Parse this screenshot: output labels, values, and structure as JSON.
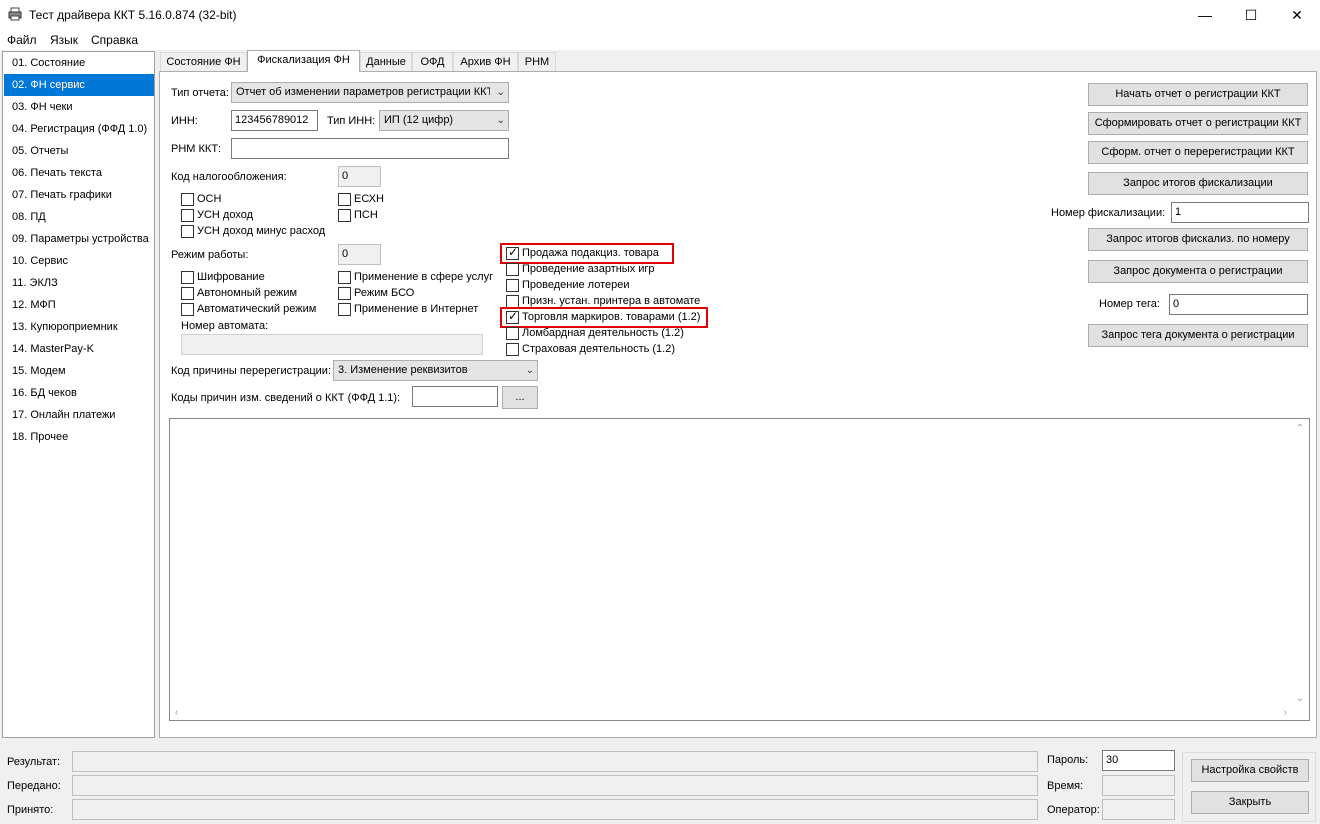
{
  "window": {
    "title": "Тест драйвера ККТ 5.16.0.874 (32-bit)",
    "minimize": "—",
    "maximize": "☐",
    "close": "✕"
  },
  "menu": [
    "Файл",
    "Язык",
    "Справка"
  ],
  "sidebar": {
    "items": [
      "01. Состояние",
      "02. ФН сервис",
      "03. ФН чеки",
      "04. Регистрация (ФФД 1.0)",
      "05. Отчеты",
      "06. Печать текста",
      "07. Печать графики",
      "08. ПД",
      "09. Параметры устройства",
      "10. Сервис",
      "11. ЭКЛЗ",
      "12. МФП",
      "13. Купюроприемник",
      "14. MasterPay-K",
      "15. Модем",
      "16. БД чеков",
      "17. Онлайн платежи",
      "18. Прочее"
    ],
    "selected": "02. ФН сервис"
  },
  "tabs": [
    "Состояние ФН",
    "Фискализация ФН",
    "Данные",
    "ОФД",
    "Архив ФН",
    "РНМ"
  ],
  "form": {
    "report_type_label": "Тип отчета:",
    "report_type_value": "Отчет об изменении параметров регистрации ККТ",
    "inn_label": "ИНН:",
    "inn_value": "123456789012",
    "inn_type_label": "Тип ИНН:",
    "inn_type_value": "ИП (12 цифр)",
    "rnm_label": "РНМ ККТ:",
    "rnm_value": "",
    "tax_code_label": "Код налогообложения:",
    "tax_code_value": "0",
    "tax_checkboxes": {
      "osn": "ОСН",
      "usn_income": "УСН доход",
      "usn_income_minus": "УСН доход минус расход",
      "eshn": "ЕСХН",
      "psn": "ПСН"
    },
    "work_mode_label": "Режим работы:",
    "work_mode_value": "0",
    "mode_checkboxes": {
      "encryption": "Шифрование",
      "autonomous": "Автономный режим",
      "automatic": "Автоматический режим",
      "services": "Применение в сфере услуг",
      "bso": "Режим БСО",
      "internet": "Применение в Интернет"
    },
    "automat_number_label": "Номер автомата:",
    "automat_number_value": "",
    "extra_checkboxes": {
      "excise": {
        "label": "Продажа подакциз. товара",
        "checked": true
      },
      "gambling": {
        "label": "Проведение азартных игр",
        "checked": false
      },
      "lottery": {
        "label": "Проведение лотереи",
        "checked": false
      },
      "printer_in_automat": {
        "label": "Призн. устан. принтера в автомате",
        "checked": false
      },
      "marking": {
        "label": "Торговля маркиров. товарами (1.2)",
        "checked": true
      },
      "pawnshop": {
        "label": "Ломбардная деятельность (1.2)",
        "checked": false
      },
      "insurance": {
        "label": "Страховая деятельность (1.2)",
        "checked": false
      }
    },
    "rereg_reason_label": "Код причины перерегистрации:",
    "rereg_reason_value": "3. Изменение реквизитов",
    "change_codes_label": "Коды причин изм. сведений о ККТ (ФФД 1.1):",
    "change_codes_value": "",
    "browse_button": "..."
  },
  "right_panel": {
    "start_report_button": "Начать отчет о регистрации ККТ",
    "make_report_button": "Сформировать отчет о регистрации ККТ",
    "make_rereg_button": "Сформ. отчет о перерегистрации ККТ",
    "query_results_button": "Запрос итогов фискализации",
    "fisc_number_label": "Номер фискализации:",
    "fisc_number_value": "1",
    "query_results_by_number_button": "Запрос итогов фискализ. по номеру",
    "query_reg_doc_button": "Запрос документа о регистрации",
    "tag_number_label": "Номер тега:",
    "tag_number_value": "0",
    "query_tag_button": "Запрос тега документа о регистрации"
  },
  "status": {
    "result_label": "Результат:",
    "sent_label": "Передано:",
    "received_label": "Принято:",
    "password_label": "Пароль:",
    "password_value": "30",
    "time_label": "Время:",
    "operator_label": "Оператор:",
    "settings_button": "Настройка свойств",
    "close_button": "Закрыть"
  },
  "colors": {
    "selection": "#0078d7",
    "highlight_box": "#e00000"
  }
}
